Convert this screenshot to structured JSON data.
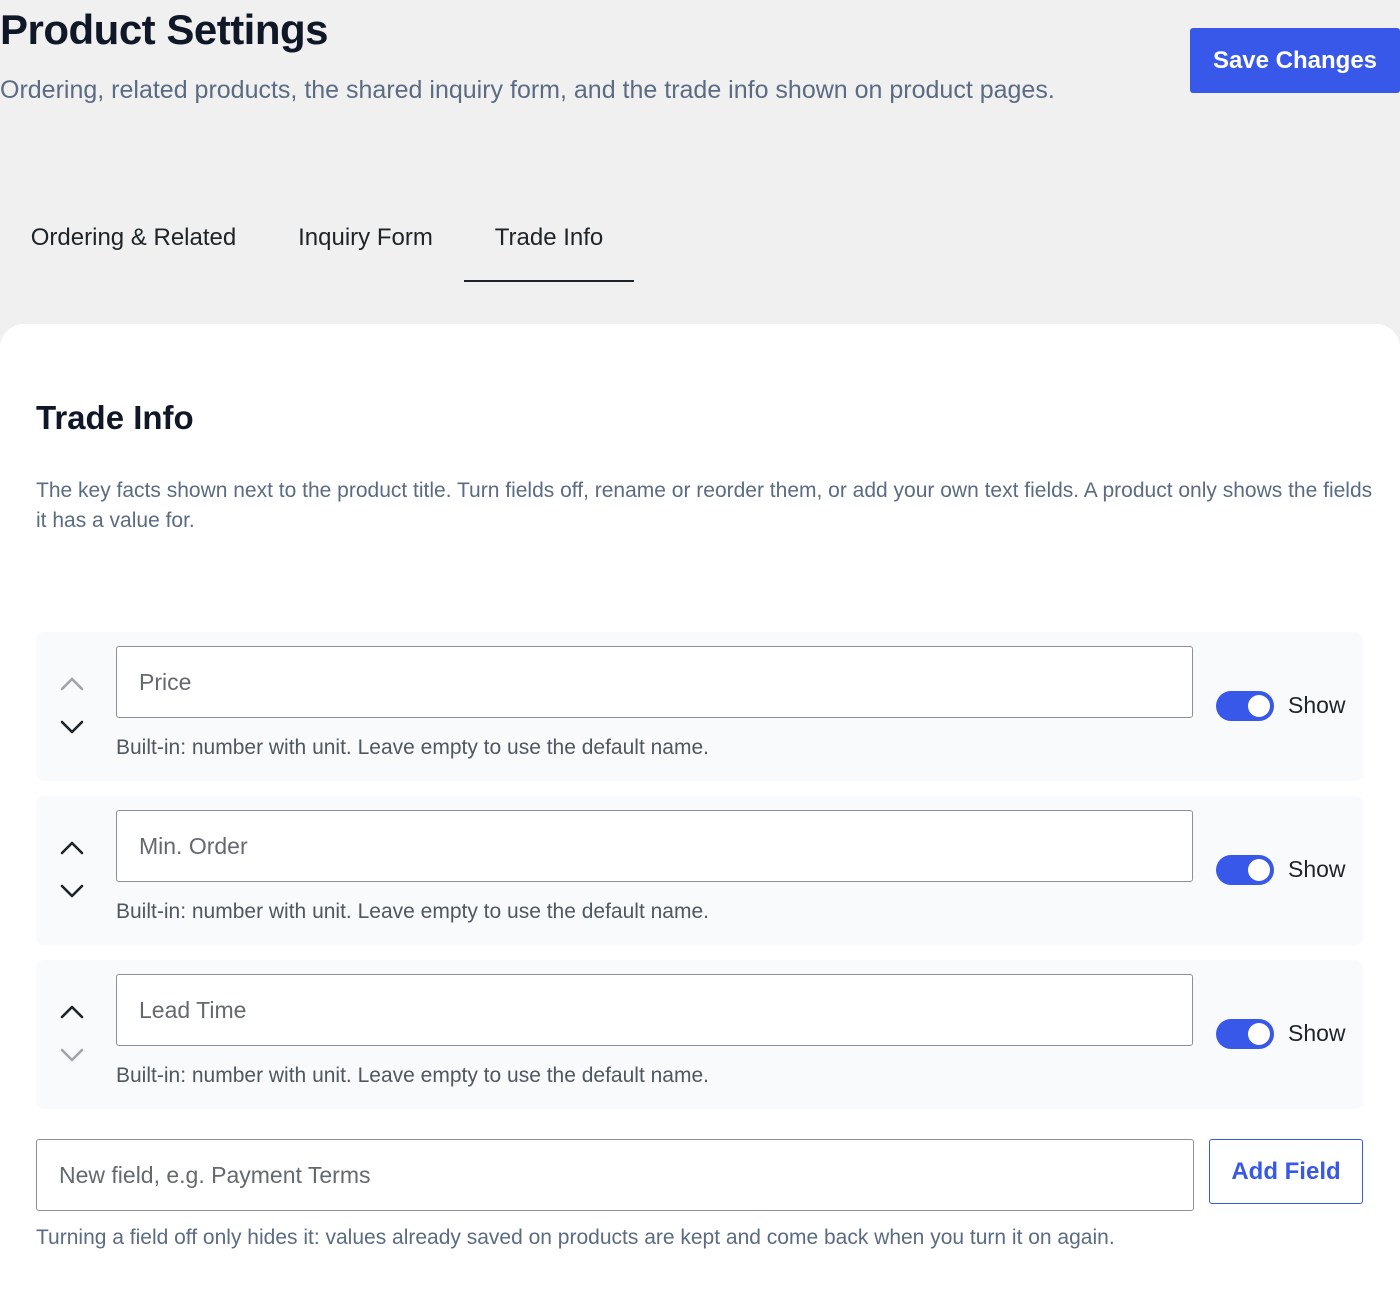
{
  "header": {
    "title": "Product Settings",
    "subtitle": "Ordering, related products, the shared inquiry form, and the trade info shown on product pages.",
    "save_label": "Save Changes"
  },
  "tabs": [
    {
      "label": "Ordering & Related",
      "active": false
    },
    {
      "label": "Inquiry Form",
      "active": false
    },
    {
      "label": "Trade Info",
      "active": true
    }
  ],
  "section": {
    "title": "Trade Info",
    "description": "The key facts shown next to the product title. Turn fields off, rename or reorder them, or add your own text fields. A product only shows the fields it has a value for."
  },
  "fields": [
    {
      "placeholder": "Price",
      "value": "",
      "help": "Built-in: number with unit. Leave empty to use the default name.",
      "show_label": "Show",
      "enabled": true,
      "can_move_up": false,
      "can_move_down": true
    },
    {
      "placeholder": "Min. Order",
      "value": "",
      "help": "Built-in: number with unit. Leave empty to use the default name.",
      "show_label": "Show",
      "enabled": true,
      "can_move_up": true,
      "can_move_down": true
    },
    {
      "placeholder": "Lead Time",
      "value": "",
      "help": "Built-in: number with unit. Leave empty to use the default name.",
      "show_label": "Show",
      "enabled": true,
      "can_move_up": true,
      "can_move_down": false
    }
  ],
  "new_field": {
    "placeholder": "New field, e.g. Payment Terms",
    "add_label": "Add Field"
  },
  "footer_note": "Turning a field off only hides it: values already saved on products are kept and come back when you turn it on again.",
  "colors": {
    "accent": "#3858e9",
    "page_background": "#f0f0f1",
    "card_background": "#ffffff",
    "row_background": "#f9fafb"
  },
  "icons": {
    "move_up": "chevron-up-icon",
    "move_down": "chevron-down-icon"
  }
}
